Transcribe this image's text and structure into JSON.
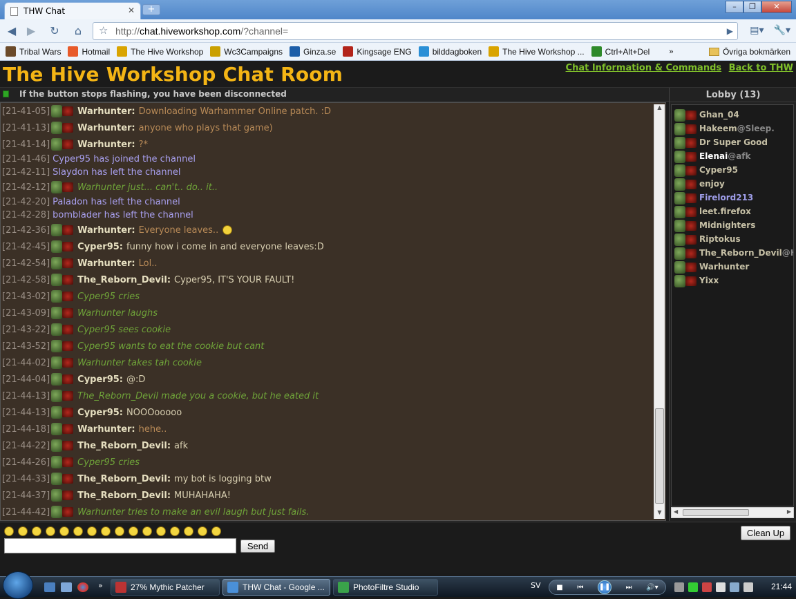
{
  "browser": {
    "tab_title": "THW Chat",
    "url_prefix": "http://",
    "url_host": "chat.hiveworkshop.com",
    "url_path": "/?channel=",
    "bookmarks": [
      {
        "label": "Tribal Wars",
        "color": "#6b4a2a"
      },
      {
        "label": "Hotmail",
        "color": "#e85a2a"
      },
      {
        "label": "The Hive Workshop",
        "color": "#d9a400"
      },
      {
        "label": "Wc3Campaigns",
        "color": "#caa000"
      },
      {
        "label": "Ginza.se",
        "color": "#1d5ea8"
      },
      {
        "label": "Kingsage ENG",
        "color": "#b3241a"
      },
      {
        "label": "bilddagboken",
        "color": "#2a8fd6"
      },
      {
        "label": "The Hive Workshop ...",
        "color": "#d9a400"
      },
      {
        "label": "Ctrl+Alt+Del",
        "color": "#2f8a2a"
      }
    ],
    "bookmarks_more": "»",
    "other_bookmarks": "Övriga bokmärken"
  },
  "page": {
    "title": "The Hive Workshop Chat Room",
    "link_info": "Chat Information & Commands",
    "link_back": "Back to THW",
    "status_text": "If the button stops flashing, you have been disconnected",
    "lobby_title": "Lobby (13)",
    "send_label": "Send",
    "cleanup_label": "Clean Up",
    "input_value": ""
  },
  "messages": [
    {
      "ts": "[21-41-05]",
      "avatar": true,
      "nick": "Warhunter:",
      "text": "Downloading Warhammer Online patch. :D",
      "style": "t-orange"
    },
    {
      "ts": "[21-41-13]",
      "avatar": true,
      "nick": "Warhunter:",
      "text": "anyone who plays that game)",
      "style": "t-orange"
    },
    {
      "ts": "[21-41-14]",
      "avatar": true,
      "nick": "Warhunter:",
      "text": "?*",
      "style": "t-orange"
    },
    {
      "ts": "[21-41-46]",
      "avatar": false,
      "nick": "",
      "text": "Cyper95 has joined the channel",
      "style": "t-system"
    },
    {
      "ts": "[21-42-11]",
      "avatar": false,
      "nick": "",
      "text": "Slaydon has left the channel",
      "style": "t-system"
    },
    {
      "ts": "[21-42-12]",
      "avatar": true,
      "nick": "",
      "text": "Warhunter just... can't.. do.. it..",
      "style": "t-action"
    },
    {
      "ts": "[21-42-20]",
      "avatar": false,
      "nick": "",
      "text": "Paladon has left the channel",
      "style": "t-system"
    },
    {
      "ts": "[21-42-28]",
      "avatar": false,
      "nick": "",
      "text": "bomblader has left the channel",
      "style": "t-system"
    },
    {
      "ts": "[21-42-36]",
      "avatar": true,
      "nick": "Warhunter:",
      "text": "Everyone leaves..",
      "style": "t-orange",
      "smiley": true
    },
    {
      "ts": "[21-42-45]",
      "avatar": true,
      "nick": "Cyper95:",
      "text": "funny how i come in and everyone leaves:D",
      "style": "t-normal"
    },
    {
      "ts": "[21-42-54]",
      "avatar": true,
      "nick": "Warhunter:",
      "text": "Lol..",
      "style": "t-orange"
    },
    {
      "ts": "[21-42-58]",
      "avatar": true,
      "nick": "The_Reborn_Devil:",
      "text": "Cyper95, IT'S YOUR FAULT!",
      "style": "t-normal"
    },
    {
      "ts": "[21-43-02]",
      "avatar": true,
      "nick": "",
      "text": "Cyper95 cries",
      "style": "t-action"
    },
    {
      "ts": "[21-43-09]",
      "avatar": true,
      "nick": "",
      "text": "Warhunter laughs",
      "style": "t-action"
    },
    {
      "ts": "[21-43-22]",
      "avatar": true,
      "nick": "",
      "text": "Cyper95 sees cookie",
      "style": "t-action"
    },
    {
      "ts": "[21-43-52]",
      "avatar": true,
      "nick": "",
      "text": "Cyper95 wants to eat the cookie but cant",
      "style": "t-action"
    },
    {
      "ts": "[21-44-02]",
      "avatar": true,
      "nick": "",
      "text": "Warhunter takes tah cookie",
      "style": "t-action"
    },
    {
      "ts": "[21-44-04]",
      "avatar": true,
      "nick": "Cyper95:",
      "text": "@:D",
      "style": "t-normal"
    },
    {
      "ts": "[21-44-13]",
      "avatar": true,
      "nick": "",
      "text": "The_Reborn_Devil made you a cookie, but he eated it",
      "style": "t-action"
    },
    {
      "ts": "[21-44-13]",
      "avatar": true,
      "nick": "Cyper95:",
      "text": "NOOOooooo",
      "style": "t-normal"
    },
    {
      "ts": "[21-44-18]",
      "avatar": true,
      "nick": "Warhunter:",
      "text": "hehe..",
      "style": "t-orange"
    },
    {
      "ts": "[21-44-22]",
      "avatar": true,
      "nick": "The_Reborn_Devil:",
      "text": "afk",
      "style": "t-normal"
    },
    {
      "ts": "[21-44-26]",
      "avatar": true,
      "nick": "",
      "text": "Cyper95 cries",
      "style": "t-action"
    },
    {
      "ts": "[21-44-33]",
      "avatar": true,
      "nick": "The_Reborn_Devil:",
      "text": "my bot is logging btw",
      "style": "t-normal"
    },
    {
      "ts": "[21-44-37]",
      "avatar": true,
      "nick": "The_Reborn_Devil:",
      "text": "MUHAHAHA!",
      "style": "t-normal"
    },
    {
      "ts": "[21-44-42]",
      "avatar": true,
      "nick": "",
      "text": "Warhunter tries to make an evil laugh but just fails.",
      "style": "t-action"
    }
  ],
  "users": [
    {
      "name": "Ghan_04",
      "suffix": "",
      "cls": ""
    },
    {
      "name": "Hakeem",
      "suffix": "@Sleep.",
      "cls": ""
    },
    {
      "name": "Dr Super Good",
      "suffix": "",
      "cls": ""
    },
    {
      "name": "Elenai",
      "suffix": "@afk",
      "cls": "white"
    },
    {
      "name": "Cyper95",
      "suffix": "",
      "cls": ""
    },
    {
      "name": "enjoy",
      "suffix": "",
      "cls": ""
    },
    {
      "name": "Firelord213",
      "suffix": "",
      "cls": "blue"
    },
    {
      "name": "leet.firefox",
      "suffix": "",
      "cls": ""
    },
    {
      "name": "Midnighters",
      "suffix": "",
      "cls": ""
    },
    {
      "name": "Riptokus",
      "suffix": "",
      "cls": ""
    },
    {
      "name": "The_Reborn_Devil",
      "suffix": "@H",
      "cls": ""
    },
    {
      "name": "Warhunter",
      "suffix": "",
      "cls": ""
    },
    {
      "name": "Yixx",
      "suffix": "",
      "cls": ""
    }
  ],
  "smiley_count": 16,
  "taskbar": {
    "tasks": [
      {
        "label": "27% Mythic Patcher",
        "color": "#b33",
        "active": false
      },
      {
        "label": "THW Chat - Google ...",
        "color": "#4a90d9",
        "active": true
      },
      {
        "label": "PhotoFiltre Studio",
        "color": "#3aa34a",
        "active": false
      }
    ],
    "lang": "SV",
    "clock": "21:44",
    "more": "»"
  },
  "colors": {
    "title": "#f4b515",
    "link": "#7fbf2a",
    "chat_bg": "#3b3026",
    "action": "#6fa339",
    "system": "#a9a0f0"
  }
}
